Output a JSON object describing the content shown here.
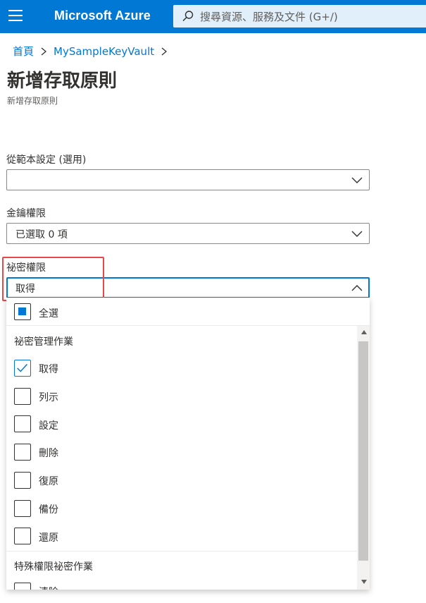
{
  "app": {
    "brand": "Microsoft Azure"
  },
  "search": {
    "placeholder": "搜尋資源、服務及文件 (G+/)"
  },
  "breadcrumb": {
    "items": [
      "首頁",
      "MySampleKeyVault"
    ]
  },
  "page": {
    "title": "新增存取原則",
    "subtitle": "新增存取原則"
  },
  "form": {
    "template": {
      "label": "從範本設定 (選用)",
      "value": ""
    },
    "key_permissions": {
      "label": "金鑰權限",
      "value": "已選取 0 項"
    },
    "secret_permissions": {
      "label": "祕密權限",
      "value": "取得",
      "select_all_label": "全選",
      "groups": [
        {
          "header": "祕密管理作業",
          "items": [
            {
              "label": "取得",
              "checked": true
            },
            {
              "label": "列示",
              "checked": false
            },
            {
              "label": "設定",
              "checked": false
            },
            {
              "label": "刪除",
              "checked": false
            },
            {
              "label": "復原",
              "checked": false
            },
            {
              "label": "備份",
              "checked": false
            },
            {
              "label": "還原",
              "checked": false
            }
          ]
        },
        {
          "header": "特殊權限祕密作業",
          "items": [
            {
              "label": "清除",
              "checked": false
            }
          ]
        }
      ]
    }
  },
  "colors": {
    "accent": "#0078d4",
    "highlight": "#e8474b"
  }
}
